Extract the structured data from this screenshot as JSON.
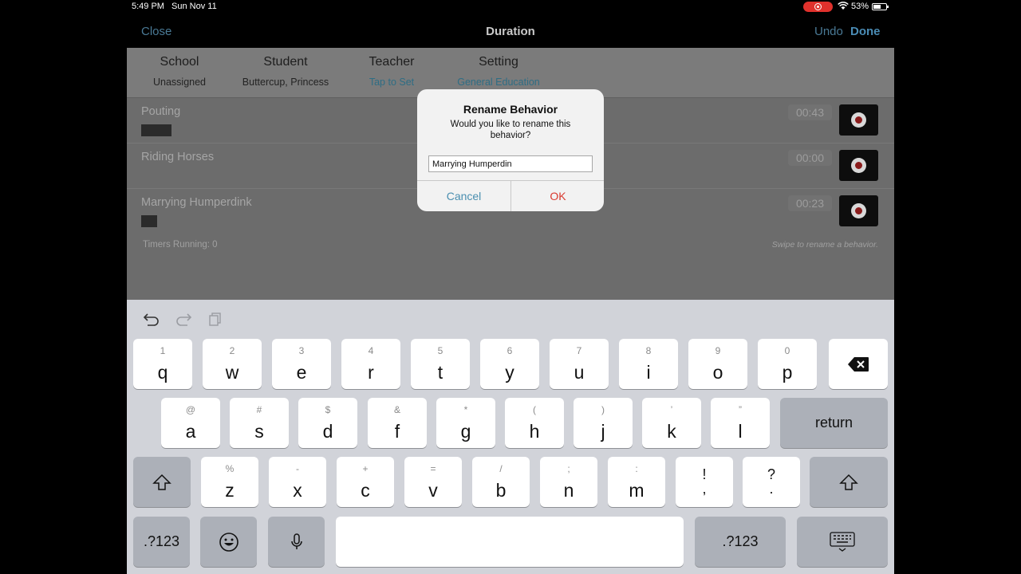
{
  "status": {
    "time": "5:49 PM",
    "date": "Sun Nov 11",
    "battery": "53%"
  },
  "nav": {
    "close": "Close",
    "title": "Duration",
    "undo": "Undo",
    "done": "Done"
  },
  "info": [
    {
      "label": "School",
      "value": "Unassigned"
    },
    {
      "label": "Student",
      "value": "Buttercup, Princess"
    },
    {
      "label": "Teacher",
      "value": "Tap to Set"
    },
    {
      "label": "Setting",
      "value": "General Education"
    }
  ],
  "behaviors": [
    {
      "name": "Pouting",
      "time": "00:43"
    },
    {
      "name": "Riding Horses",
      "time": "00:00"
    },
    {
      "name": "Marrying Humperdink",
      "time": "00:23"
    }
  ],
  "footer": {
    "timers": "Timers Running: 0",
    "hint": "Swipe to rename a behavior."
  },
  "alert": {
    "title": "Rename Behavior",
    "message": "Would you like to rename this behavior?",
    "input_value": "Marrying Humperdin",
    "cancel": "Cancel",
    "ok": "OK"
  },
  "keyboard": {
    "row1": [
      {
        "alt": "1",
        "key": "q"
      },
      {
        "alt": "2",
        "key": "w"
      },
      {
        "alt": "3",
        "key": "e"
      },
      {
        "alt": "4",
        "key": "r"
      },
      {
        "alt": "5",
        "key": "t"
      },
      {
        "alt": "6",
        "key": "y"
      },
      {
        "alt": "7",
        "key": "u"
      },
      {
        "alt": "8",
        "key": "i"
      },
      {
        "alt": "9",
        "key": "o"
      },
      {
        "alt": "0",
        "key": "p"
      }
    ],
    "row2": [
      {
        "alt": "@",
        "key": "a"
      },
      {
        "alt": "#",
        "key": "s"
      },
      {
        "alt": "$",
        "key": "d"
      },
      {
        "alt": "&",
        "key": "f"
      },
      {
        "alt": "*",
        "key": "g"
      },
      {
        "alt": "(",
        "key": "h"
      },
      {
        "alt": ")",
        "key": "j"
      },
      {
        "alt": "’",
        "key": "k"
      },
      {
        "alt": "”",
        "key": "l"
      }
    ],
    "row3": [
      {
        "alt": "%",
        "key": "z"
      },
      {
        "alt": "-",
        "key": "x"
      },
      {
        "alt": "+",
        "key": "c"
      },
      {
        "alt": "=",
        "key": "v"
      },
      {
        "alt": "/",
        "key": "b"
      },
      {
        "alt": ";",
        "key": "n"
      },
      {
        "alt": ":",
        "key": "m"
      }
    ],
    "punct": [
      {
        "top": "!",
        "bottom": ","
      },
      {
        "top": "?",
        "bottom": "."
      }
    ],
    "return": "return",
    "numbers": ".?123"
  },
  "colors": {
    "accent": "#4a8fb0",
    "destructive": "#d93a2f",
    "recording": "#e0312c"
  }
}
